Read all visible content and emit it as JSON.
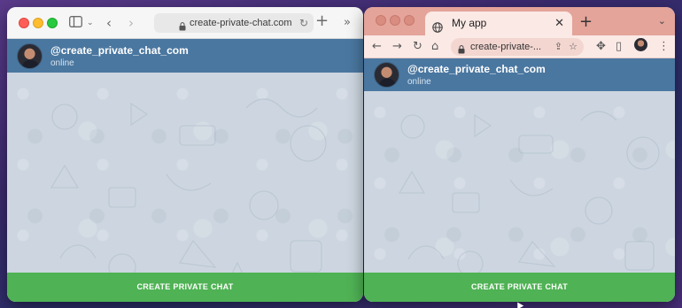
{
  "safari": {
    "url": "create-private-chat.com",
    "chat": {
      "username": "@create_private_chat_com",
      "status": "online",
      "cta_label": "CREATE PRIVATE CHAT"
    }
  },
  "chrome": {
    "tab_title": "My app",
    "url": "create-private-...",
    "chat": {
      "username": "@create_private_chat_com",
      "status": "online",
      "cta_label": "CREATE PRIVATE CHAT"
    }
  },
  "colors": {
    "header": "#4a77a0",
    "cta": "#4fb254",
    "chat_bg": "#cdd6e0",
    "chrome_frame": "#e4a49a"
  },
  "icons": [
    "sidebar-icon",
    "chevron-left-icon",
    "chevron-right-icon",
    "lock-icon",
    "reload-icon",
    "plus-icon",
    "double-chevron-icon",
    "globe-icon",
    "close-icon",
    "home-icon",
    "share-icon",
    "star-icon",
    "extensions-icon",
    "side-panel-icon",
    "kebab-menu-icon"
  ]
}
